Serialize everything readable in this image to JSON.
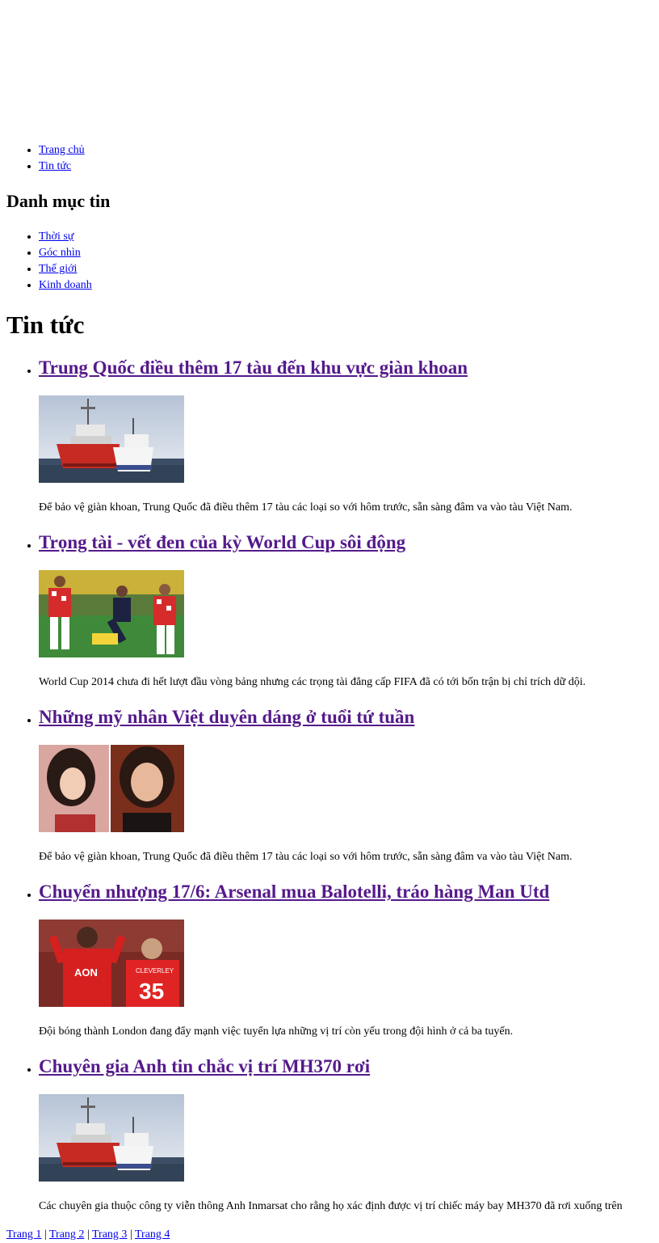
{
  "nav": {
    "items": [
      {
        "label": "Trang chủ"
      },
      {
        "label": "Tin tức"
      }
    ]
  },
  "categories": {
    "heading": "Danh mục tin",
    "items": [
      {
        "label": "Thời sự"
      },
      {
        "label": "Góc nhìn"
      },
      {
        "label": "Thế giới"
      },
      {
        "label": "Kinh doanh"
      }
    ]
  },
  "main": {
    "title": "Tin tức",
    "articles": [
      {
        "title": "Trung Quốc điều thêm 17 tàu đến khu vực giàn khoan",
        "summary": "Để bảo vệ giàn khoan, Trung Quốc đã điều thêm 17 tàu các loại so với hôm trước, sẵn sàng đâm va vào tàu Việt Nam.",
        "image": "ships-at-sea-photo"
      },
      {
        "title": "Trọng tài - vết đen của kỳ World Cup sôi động",
        "summary": "World Cup 2014 chưa đi hết lượt đầu vòng bảng nhưng các trọng tài đẳng cấp FIFA đã có tới bốn trận bị chỉ trích dữ dội.",
        "image": "football-referee-photo"
      },
      {
        "title": "Những mỹ nhân Việt duyên dáng ở tuổi tứ tuần",
        "summary": "Để bảo vệ giàn khoan, Trung Quốc đã điều thêm 17 tàu các loại so với hôm trước, sẵn sàng đâm va vào tàu Việt Nam.",
        "image": "two-women-portrait-photo"
      },
      {
        "title": "Chuyển nhượng 17/6: Arsenal mua Balotelli, tráo hàng Man Utd",
        "summary": "Đội bóng thành London đang đẩy mạnh việc tuyển lựa những vị trí còn yếu trong đội hình ở cả ba tuyến.",
        "image": "man-utd-players-photo",
        "jersey_number": "35",
        "jersey_name": "CLEVERLEY",
        "sponsor": "AON"
      },
      {
        "title": "Chuyên gia Anh tin chắc vị trí MH370 rơi",
        "summary": "Các chuyên gia thuộc công ty viễn thông Anh Inmarsat cho rằng họ xác định được vị trí chiếc máy bay MH370 đã rơi xuống trên",
        "image": "ships-at-sea-photo"
      }
    ]
  },
  "pagination": {
    "pages": [
      "Trang 1",
      "Trang 2",
      "Trang 3",
      "Trang 4"
    ],
    "separator": "|"
  },
  "colors": {
    "link": "#0000ee",
    "visited_link": "#551a8b",
    "text": "#000000",
    "background": "#ffffff"
  }
}
